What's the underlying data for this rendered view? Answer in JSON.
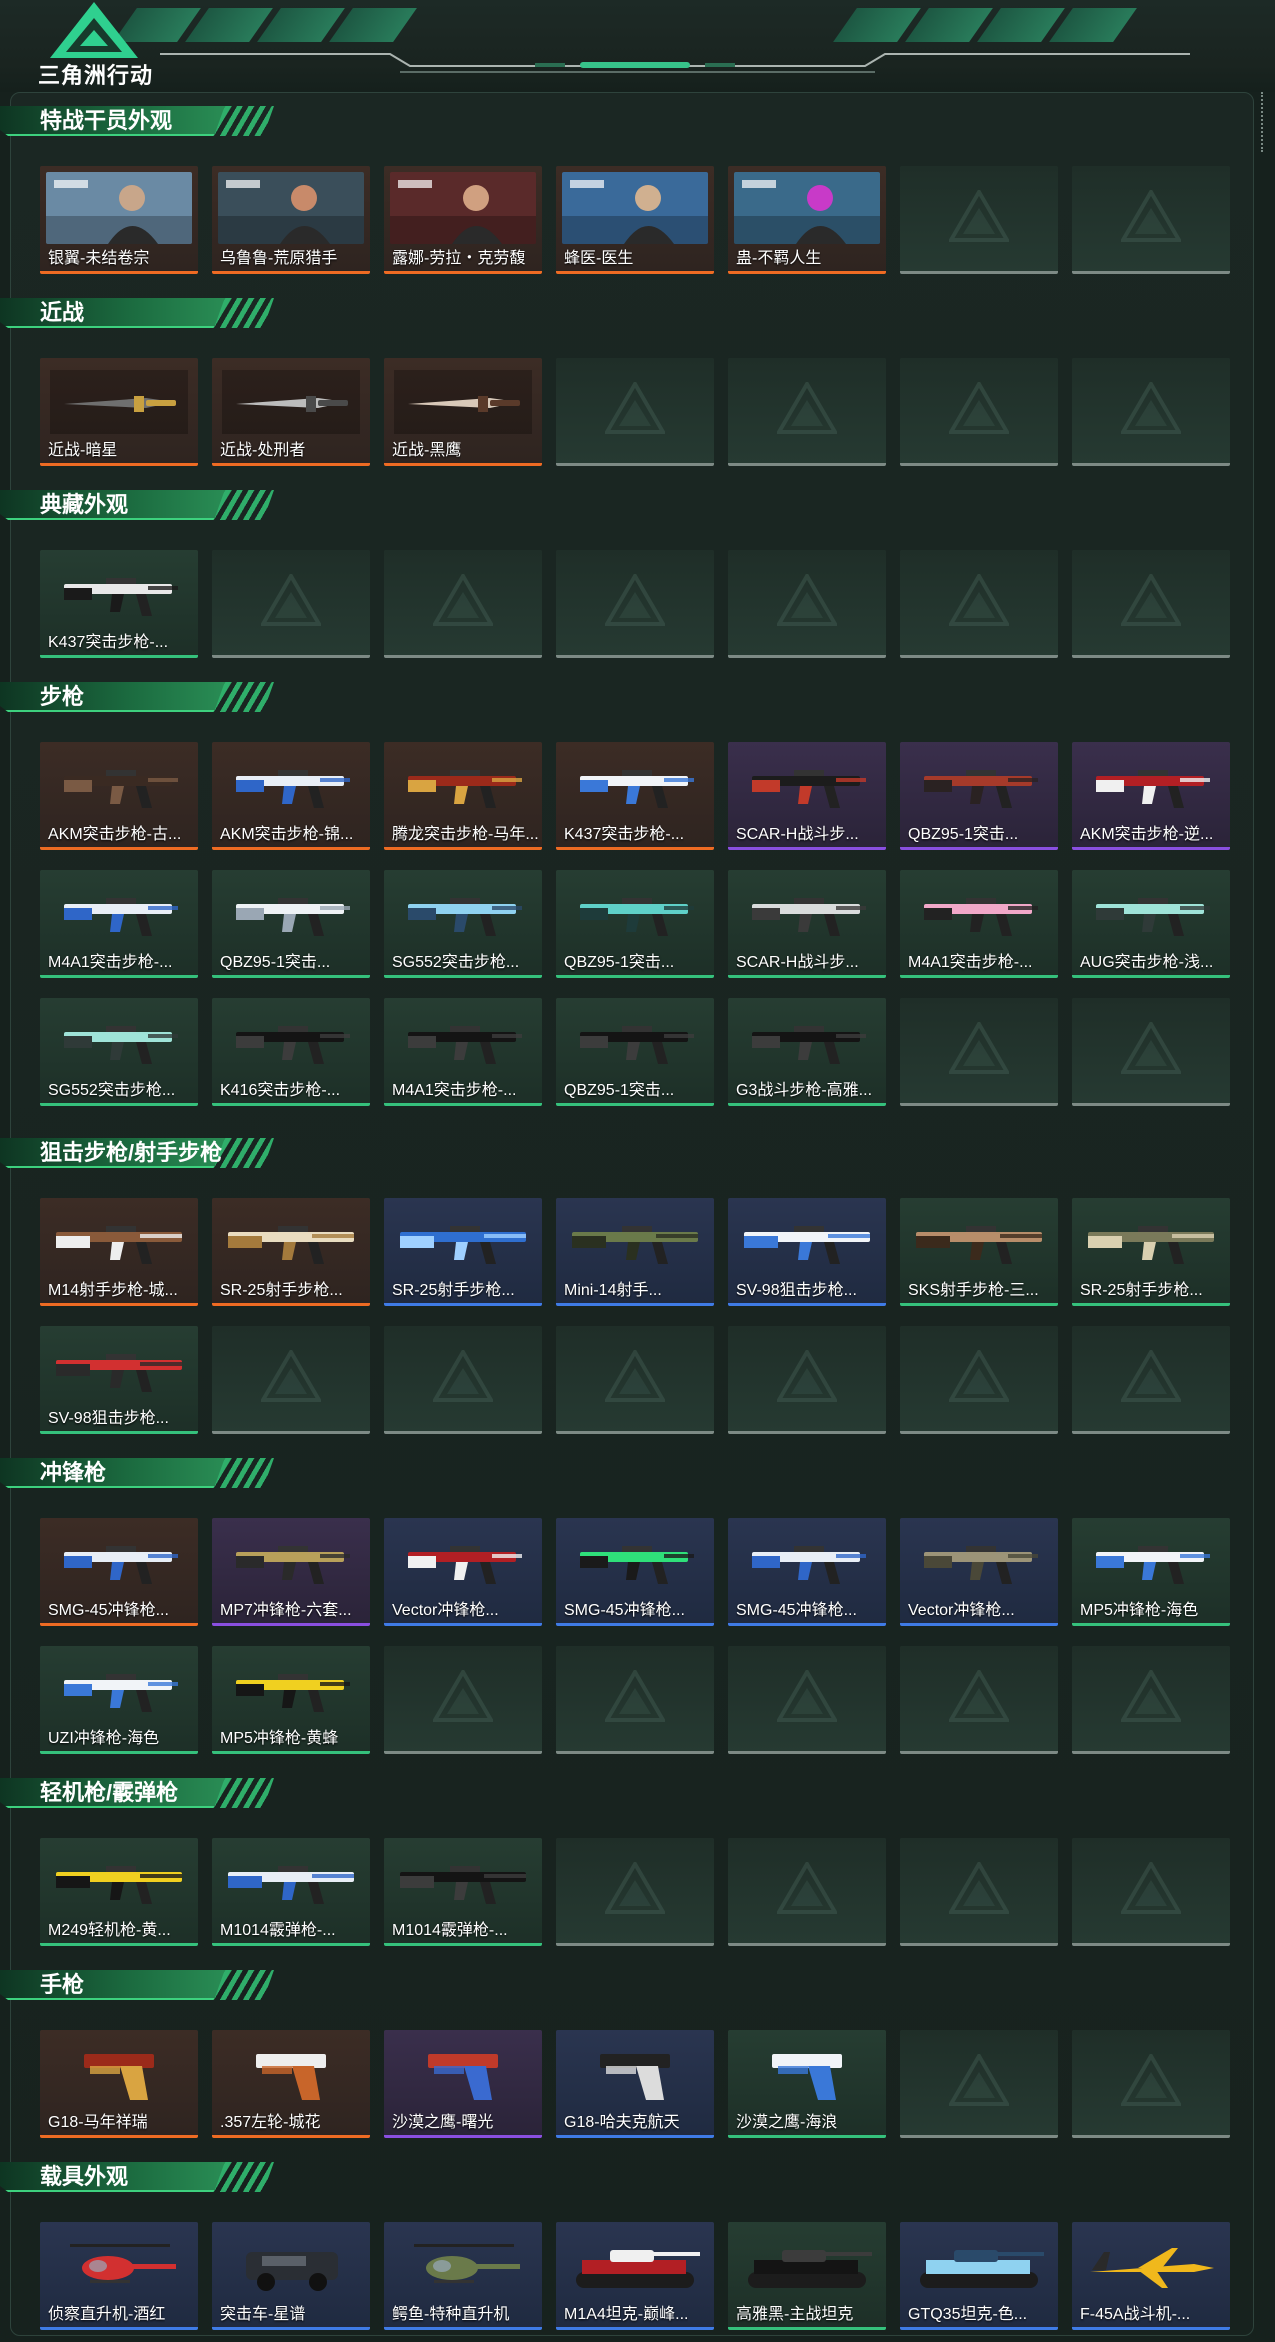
{
  "header": {
    "logo_text": "三角洲行动"
  },
  "icons": {
    "logo": "delta-triangle-logo",
    "placeholder": "delta-watermark-icon"
  },
  "colors": {
    "orange": "#ee6b23",
    "purple": "#8a4fe0",
    "blue": "#3f7be6",
    "green": "#35c17c",
    "empty": "#7d8a85"
  },
  "sections": [
    {
      "title": "特战干员外观",
      "rows": 1,
      "items": [
        {
          "label": "银翼-未结卷宗",
          "rarity": "orange",
          "kind": "portrait",
          "art": "operator-1"
        },
        {
          "label": "乌鲁鲁-荒原猎手",
          "rarity": "orange",
          "kind": "portrait",
          "art": "operator-2"
        },
        {
          "label": "露娜-劳拉・克劳馥",
          "rarity": "orange",
          "kind": "portrait",
          "art": "operator-3"
        },
        {
          "label": "蜂医-医生",
          "rarity": "orange",
          "kind": "portrait",
          "art": "operator-4"
        },
        {
          "label": "蛊-不羁人生",
          "rarity": "orange",
          "kind": "portrait",
          "art": "operator-5"
        }
      ]
    },
    {
      "title": "近战",
      "rows": 1,
      "items": [
        {
          "label": "近战-暗星",
          "rarity": "orange",
          "kind": "knife",
          "art": "knife-dark"
        },
        {
          "label": "近战-处刑者",
          "rarity": "orange",
          "kind": "knife",
          "art": "knife-grey"
        },
        {
          "label": "近战-黑鹰",
          "rarity": "orange",
          "kind": "knife",
          "art": "knife-tan"
        }
      ]
    },
    {
      "title": "典藏外观",
      "rows": 1,
      "items": [
        {
          "label": "K437突击步枪-...",
          "rarity": "green",
          "kind": "gun",
          "art": "zebra"
        }
      ]
    },
    {
      "title": "步枪",
      "rows": 3,
      "items": [
        {
          "label": "AKM突击步枪-古...",
          "rarity": "orange",
          "kind": "gun",
          "art": "dark-brown"
        },
        {
          "label": "AKM突击步枪-锦...",
          "rarity": "orange",
          "kind": "gun",
          "art": "blue-white"
        },
        {
          "label": "腾龙突击步枪-马年...",
          "rarity": "orange",
          "kind": "gun",
          "art": "red-gold"
        },
        {
          "label": "K437突击步枪-...",
          "rarity": "orange",
          "kind": "gun",
          "art": "white-blue"
        },
        {
          "label": "SCAR-H战斗步...",
          "rarity": "purple",
          "kind": "gun",
          "art": "black-red"
        },
        {
          "label": "QBZ95-1突击...",
          "rarity": "purple",
          "kind": "gun",
          "art": "red-dark"
        },
        {
          "label": "AKM突击步枪-逆...",
          "rarity": "purple",
          "kind": "gun",
          "art": "red-white"
        },
        {
          "label": "M4A1突击步枪-...",
          "rarity": "green",
          "kind": "gun",
          "art": "blue-white"
        },
        {
          "label": "QBZ95-1突击...",
          "rarity": "green",
          "kind": "gun",
          "art": "white"
        },
        {
          "label": "SG552突击步枪...",
          "rarity": "green",
          "kind": "gun",
          "art": "sky-blue"
        },
        {
          "label": "QBZ95-1突击...",
          "rarity": "green",
          "kind": "gun",
          "art": "teal"
        },
        {
          "label": "SCAR-H战斗步...",
          "rarity": "green",
          "kind": "gun",
          "art": "light-grey"
        },
        {
          "label": "M4A1突击步枪-...",
          "rarity": "green",
          "kind": "gun",
          "art": "pink"
        },
        {
          "label": "AUG突击步枪-浅...",
          "rarity": "green",
          "kind": "gun",
          "art": "mint"
        },
        {
          "label": "SG552突击步枪...",
          "rarity": "green",
          "kind": "gun",
          "art": "mint"
        },
        {
          "label": "K416突击步枪-...",
          "rarity": "green",
          "kind": "gun",
          "art": "black"
        },
        {
          "label": "M4A1突击步枪-...",
          "rarity": "green",
          "kind": "gun",
          "art": "black"
        },
        {
          "label": "QBZ95-1突击...",
          "rarity": "green",
          "kind": "gun",
          "art": "black"
        },
        {
          "label": "G3战斗步枪-高雅...",
          "rarity": "green",
          "kind": "gun",
          "art": "black"
        }
      ]
    },
    {
      "title": "狙击步枪/射手步枪",
      "rows": 2,
      "items": [
        {
          "label": "M14射手步枪-城...",
          "rarity": "orange",
          "kind": "rifle",
          "art": "brown-white"
        },
        {
          "label": "SR-25射手步枪...",
          "rarity": "orange",
          "kind": "rifle",
          "art": "gold-white"
        },
        {
          "label": "SR-25射手步枪...",
          "rarity": "blue",
          "kind": "rifle",
          "art": "blue-camo"
        },
        {
          "label": "Mini-14射手...",
          "rarity": "blue",
          "kind": "rifle",
          "art": "olive"
        },
        {
          "label": "SV-98狙击步枪...",
          "rarity": "blue",
          "kind": "rifle",
          "art": "white-blue"
        },
        {
          "label": "SKS射手步枪-三...",
          "rarity": "green",
          "kind": "rifle",
          "art": "desert"
        },
        {
          "label": "SR-25射手步枪...",
          "rarity": "green",
          "kind": "rifle",
          "art": "woodland"
        },
        {
          "label": "SV-98狙击步枪...",
          "rarity": "green",
          "kind": "rifle",
          "art": "red"
        }
      ]
    },
    {
      "title": "冲锋枪",
      "rows": 2,
      "items": [
        {
          "label": "SMG-45冲锋枪...",
          "rarity": "orange",
          "kind": "gun",
          "art": "blue-white"
        },
        {
          "label": "MP7冲锋枪-六套...",
          "rarity": "purple",
          "kind": "gun",
          "art": "gold-dark"
        },
        {
          "label": "Vector冲锋枪...",
          "rarity": "blue",
          "kind": "gun",
          "art": "red-white"
        },
        {
          "label": "SMG-45冲锋枪...",
          "rarity": "blue",
          "kind": "gun",
          "art": "green-glow"
        },
        {
          "label": "SMG-45冲锋枪...",
          "rarity": "blue",
          "kind": "gun",
          "art": "blue-white"
        },
        {
          "label": "Vector冲锋枪...",
          "rarity": "blue",
          "kind": "gun",
          "art": "camo"
        },
        {
          "label": "MP5冲锋枪-海色",
          "rarity": "green",
          "kind": "gun",
          "art": "white-blue"
        },
        {
          "label": "UZI冲锋枪-海色",
          "rarity": "green",
          "kind": "gun",
          "art": "white-blue"
        },
        {
          "label": "MP5冲锋枪-黄蜂",
          "rarity": "green",
          "kind": "gun",
          "art": "yellow-black"
        }
      ]
    },
    {
      "title": "轻机枪/霰弹枪",
      "rows": 1,
      "items": [
        {
          "label": "M249轻机枪-黄...",
          "rarity": "green",
          "kind": "rifle",
          "art": "yellow-black"
        },
        {
          "label": "M1014霰弹枪-...",
          "rarity": "green",
          "kind": "rifle",
          "art": "blue-white"
        },
        {
          "label": "M1014霰弹枪-...",
          "rarity": "green",
          "kind": "rifle",
          "art": "black"
        }
      ]
    },
    {
      "title": "手枪",
      "rows": 1,
      "items": [
        {
          "label": "G18-马年祥瑞",
          "rarity": "orange",
          "kind": "pistol",
          "art": "red-gold"
        },
        {
          "label": ".357左轮-城花",
          "rarity": "orange",
          "kind": "pistol",
          "art": "white-orange"
        },
        {
          "label": "沙漠之鹰-曙光",
          "rarity": "purple",
          "kind": "pistol",
          "art": "red-blue"
        },
        {
          "label": "G18-哈夫克航天",
          "rarity": "blue",
          "kind": "pistol",
          "art": "black-white"
        },
        {
          "label": "沙漠之鹰-海浪",
          "rarity": "green",
          "kind": "pistol",
          "art": "white-blue"
        }
      ]
    },
    {
      "title": "载具外观",
      "rows": 1,
      "items": [
        {
          "label": "侦察直升机-酒红",
          "rarity": "blue",
          "kind": "heli",
          "art": "red"
        },
        {
          "label": "突击车-星谱",
          "rarity": "blue",
          "kind": "car",
          "art": "dark"
        },
        {
          "label": "鳄鱼-特种直升机",
          "rarity": "blue",
          "kind": "heli",
          "art": "olive"
        },
        {
          "label": "M1A4坦克-巅峰...",
          "rarity": "blue",
          "kind": "tank",
          "art": "red-white"
        },
        {
          "label": "高雅黑-主战坦克",
          "rarity": "green",
          "kind": "tank",
          "art": "black"
        },
        {
          "label": "GTQ35坦克-色...",
          "rarity": "blue",
          "kind": "tank",
          "art": "sky-blue"
        },
        {
          "label": "F-45A战斗机-...",
          "rarity": "blue",
          "kind": "jet",
          "art": "yellow"
        }
      ]
    }
  ]
}
